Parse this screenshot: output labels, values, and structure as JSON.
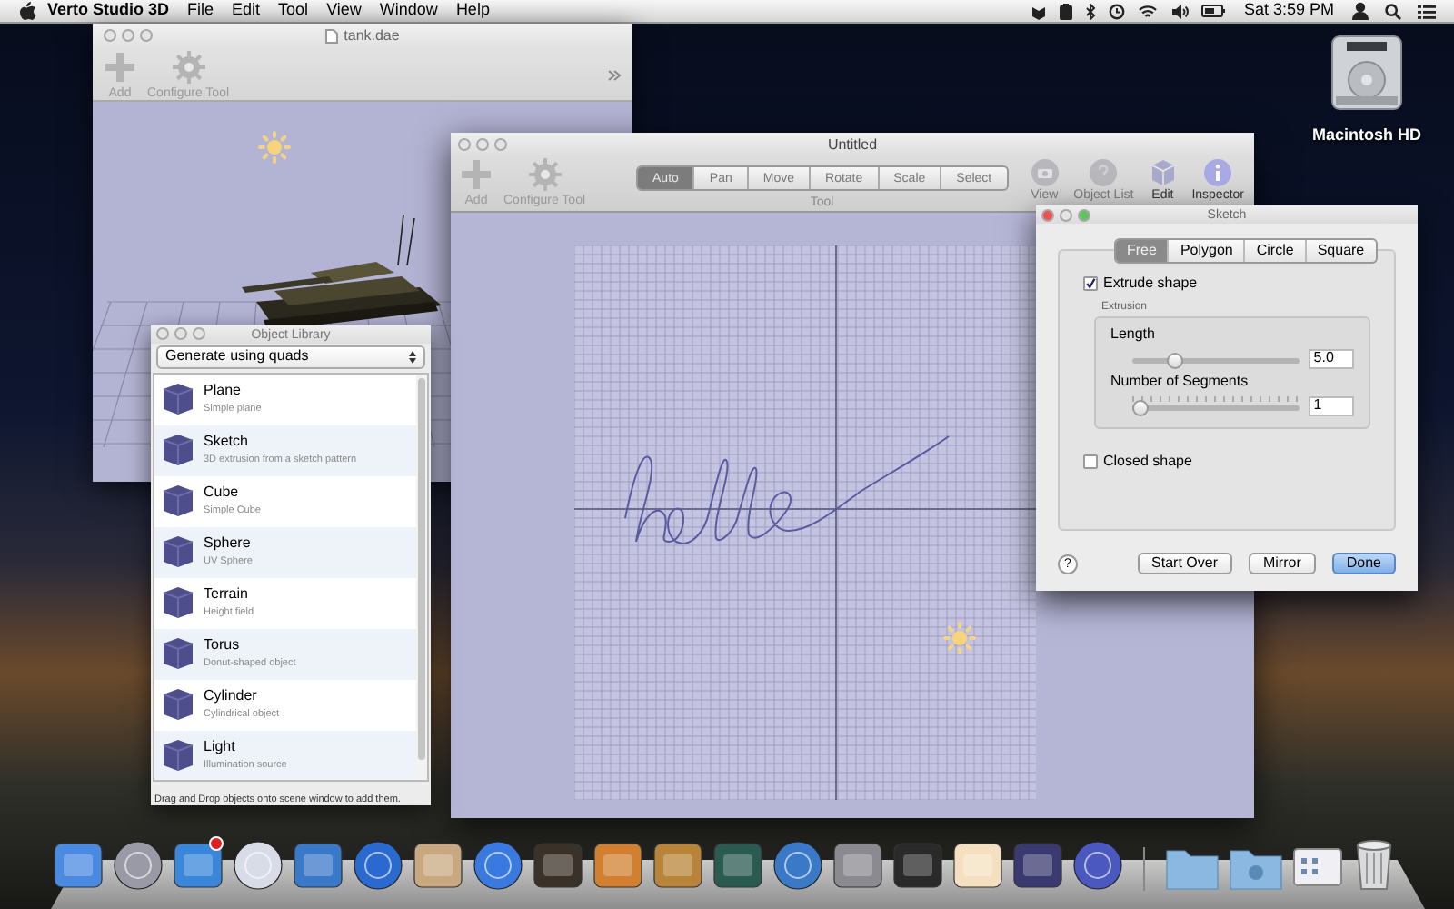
{
  "menu_bar": {
    "app_name": "Verto Studio 3D",
    "menus": [
      "File",
      "Edit",
      "Tool",
      "View",
      "Window",
      "Help"
    ],
    "clock": "Sat 3:59 PM"
  },
  "desktop_icon": {
    "label": "Macintosh HD"
  },
  "tank_window": {
    "title": "tank.dae",
    "toolbar": [
      {
        "label": "Add",
        "kind": "add"
      },
      {
        "label": "Configure Tool",
        "kind": "configure"
      }
    ]
  },
  "scene_window": {
    "title": "Untitled",
    "toolbar": [
      {
        "label": "Add",
        "kind": "add"
      },
      {
        "label": "Configure Tool",
        "kind": "configure"
      }
    ],
    "tool_group": {
      "label": "Tool",
      "tools": [
        {
          "label": "Auto",
          "selected": true
        },
        {
          "label": "Pan",
          "selected": false
        },
        {
          "label": "Move",
          "selected": false
        },
        {
          "label": "Rotate",
          "selected": false
        },
        {
          "label": "Scale",
          "selected": false
        },
        {
          "label": "Select",
          "selected": false
        }
      ]
    },
    "right_toolbar": [
      {
        "label": "View",
        "kind": "camera",
        "disabled": true
      },
      {
        "label": "Object List",
        "kind": "list",
        "disabled": true
      },
      {
        "label": "Edit",
        "kind": "cube",
        "disabled": false
      },
      {
        "label": "Inspector",
        "kind": "info",
        "disabled": false
      }
    ]
  },
  "sketch_panel": {
    "title": "Sketch",
    "tabs": [
      {
        "label": "Free",
        "selected": true
      },
      {
        "label": "Polygon",
        "selected": false
      },
      {
        "label": "Circle",
        "selected": false
      },
      {
        "label": "Square",
        "selected": false
      }
    ],
    "extrude": {
      "label": "Extrude shape",
      "checked": true
    },
    "extrusion_label": "Extrusion",
    "sliders": [
      {
        "label": "Length",
        "level": 0.2,
        "value": "5.0",
        "kind": "plain"
      },
      {
        "label": "Number of Segments",
        "level": 0,
        "value": "1",
        "kind": "ticked"
      }
    ],
    "closed": {
      "label": "Closed shape",
      "checked": false
    },
    "help_button": "?",
    "buttons": [
      {
        "label": "Start Over",
        "default": false
      },
      {
        "label": "Mirror",
        "default": false
      },
      {
        "label": "Done",
        "default": true
      }
    ]
  },
  "object_library": {
    "title": "Object Library",
    "generator": "Generate using quads",
    "items": [
      {
        "name": "Plane",
        "description": "Simple plane"
      },
      {
        "name": "Sketch",
        "description": "3D extrusion from a sketch pattern"
      },
      {
        "name": "Cube",
        "description": "Simple Cube"
      },
      {
        "name": "Sphere",
        "description": "UV Sphere"
      },
      {
        "name": "Terrain",
        "description": "Height field"
      },
      {
        "name": "Torus",
        "description": "Donut-shaped object"
      },
      {
        "name": "Cylinder",
        "description": "Cylindrical object"
      },
      {
        "name": "Light",
        "description": "Illumination source"
      }
    ],
    "footer": "Drag and Drop objects onto scene window to add them."
  }
}
